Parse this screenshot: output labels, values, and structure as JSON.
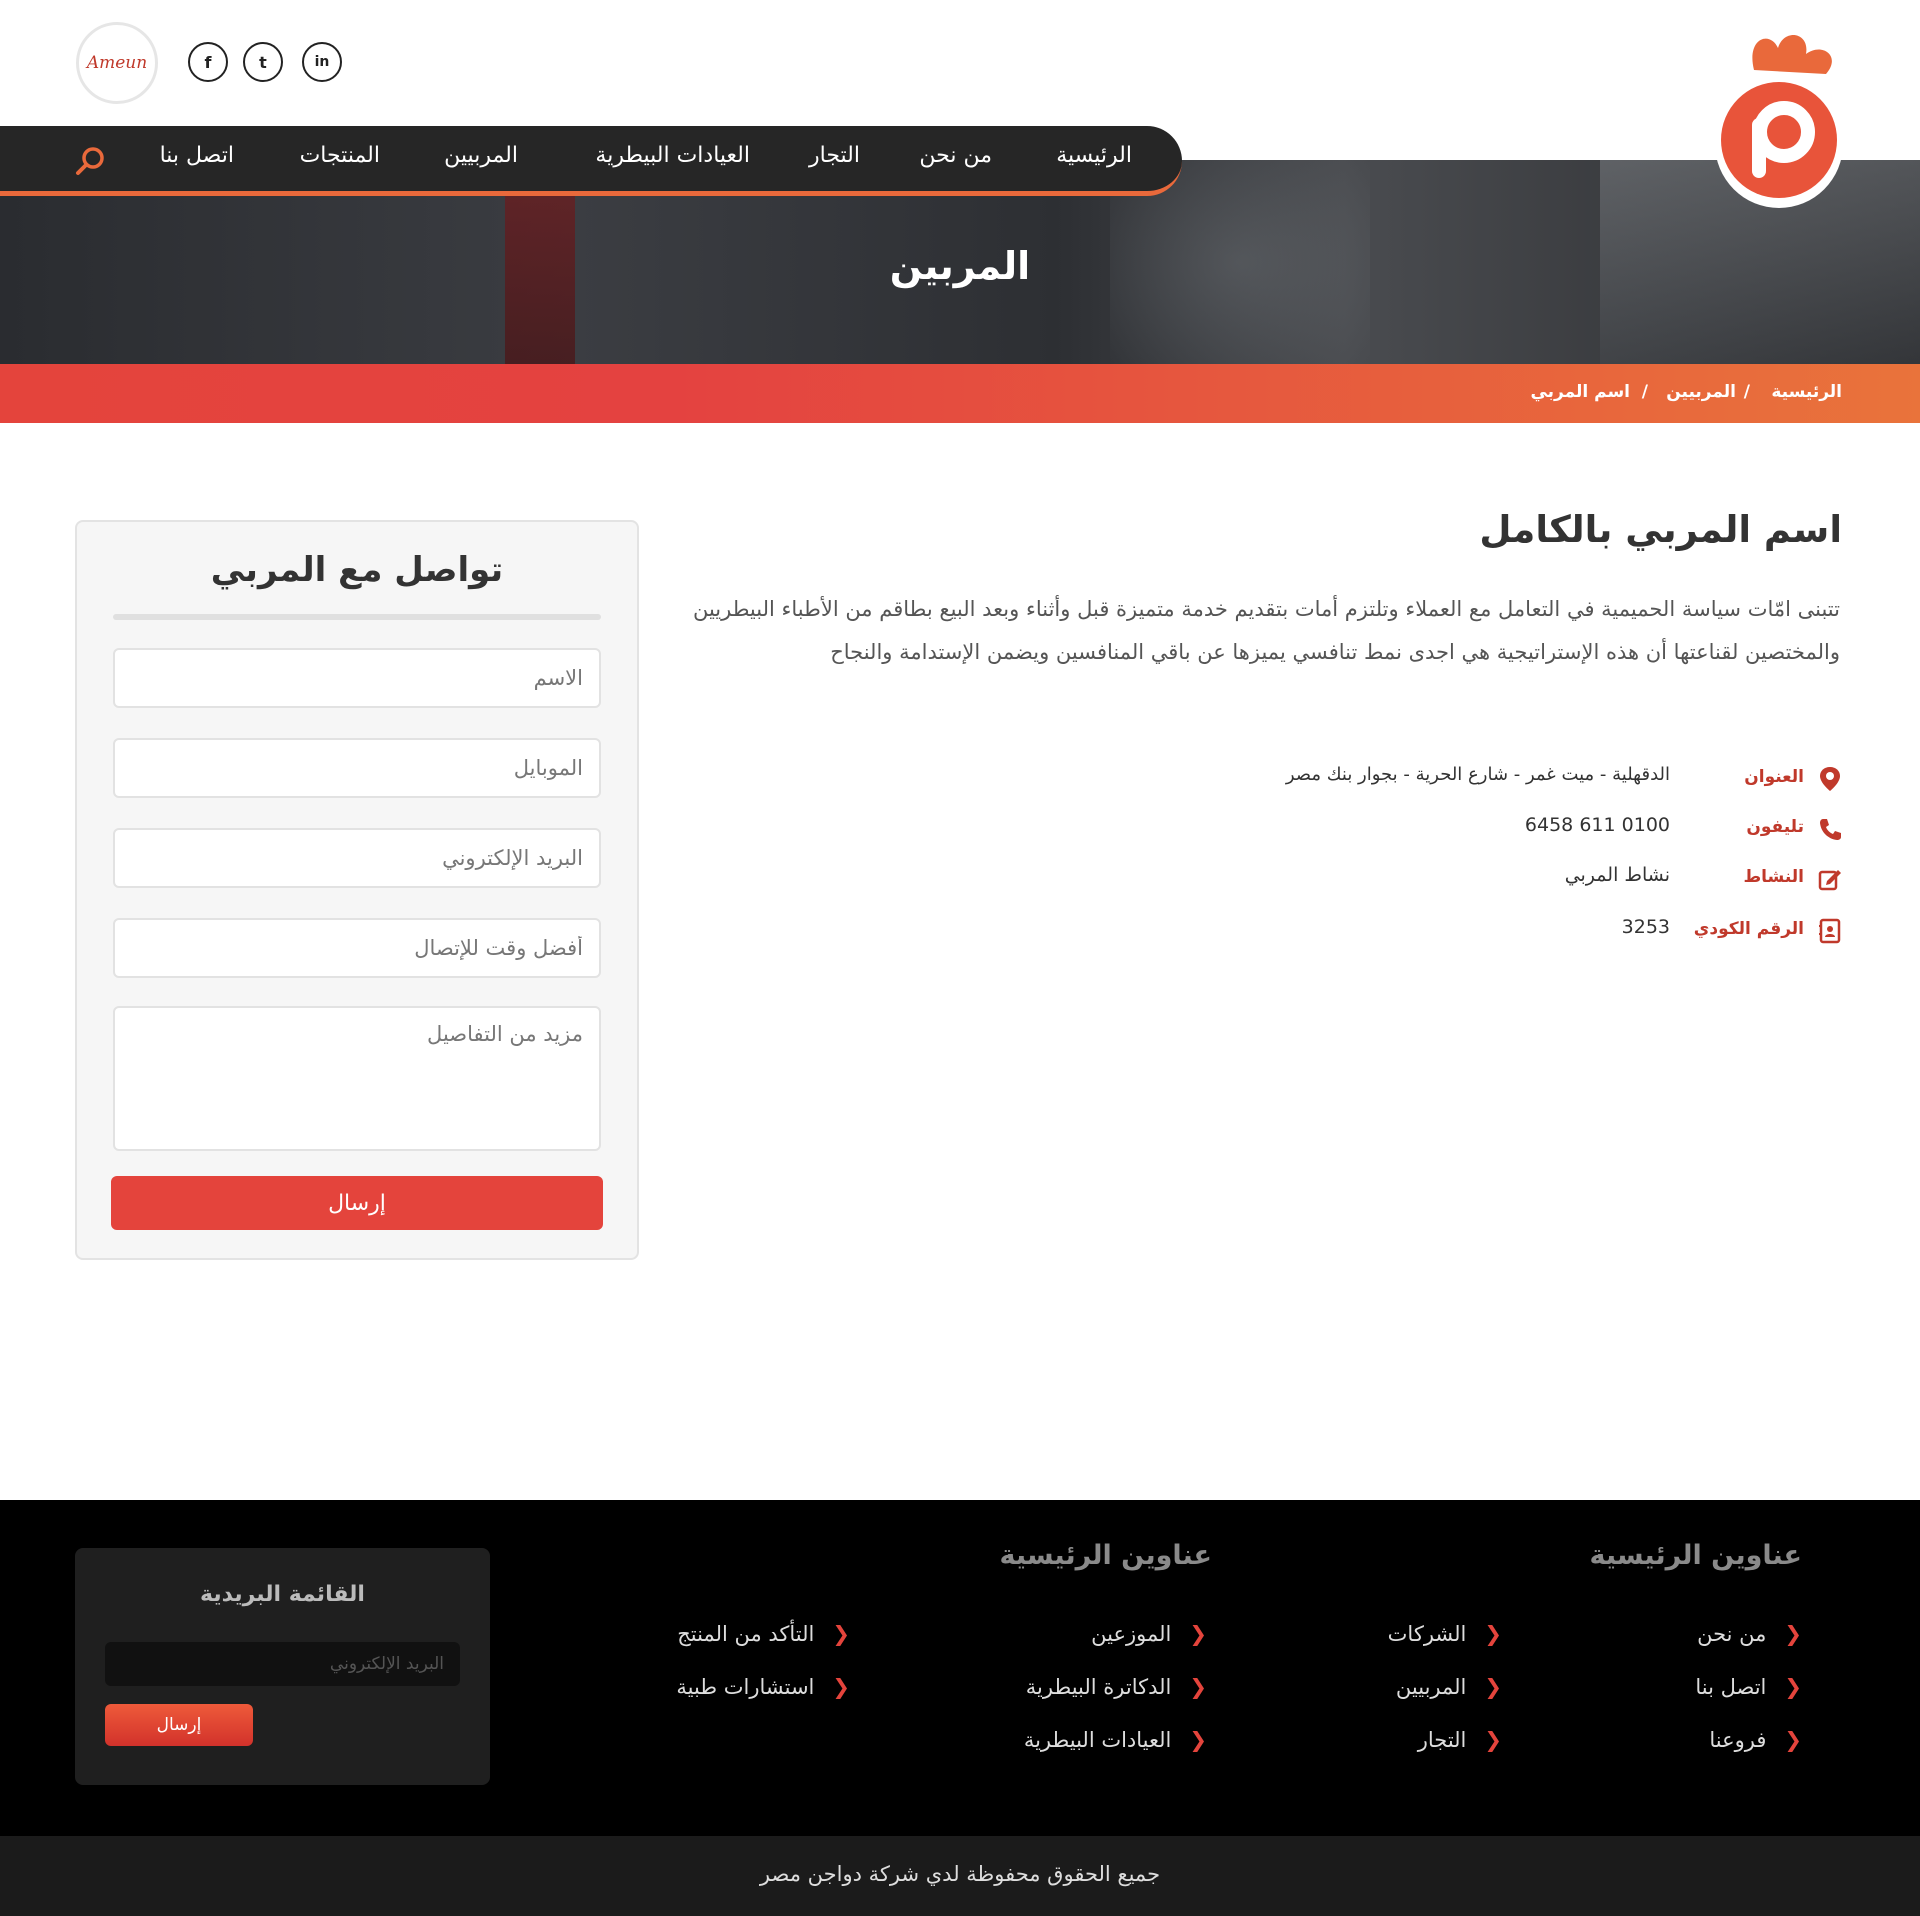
{
  "header": {
    "partner_logo_text": "Ameun",
    "social": [
      "f",
      "t",
      "in"
    ]
  },
  "nav": {
    "items": [
      "الرئيسية",
      "من نحن",
      "التجار",
      "العيادات البيطرية",
      "المربيين",
      "المنتجات",
      "اتصل بنا"
    ]
  },
  "hero": {
    "title": "المربين"
  },
  "breadcrumb": {
    "home": "الرئيسية",
    "sep": "/",
    "section": "المربيين",
    "current": "اسم المربي"
  },
  "breeder": {
    "name": "اسم المربي بالكامل",
    "description": "تتبنى امّات سياسة الحميمية في التعامل مع العملاء وتلتزم أمات بتقديم خدمة متميزة قبل وأثناء وبعد البيع بطاقم من الأطباء البيطريين والمختصين لقناعتها أن هذه الإستراتيجية هي اجدى نمط تنافسي يميزها عن باقي المنافسين ويضمن الإستدامة والنجاح",
    "info": {
      "address_label": "العنوان",
      "address": "الدقهلية - ميت غمر - شارع الحرية - بجوار بنك مصر",
      "phone_label": "تليفون",
      "phone": "0100 611 6458",
      "activity_label": "النشاط",
      "activity": "نشاط المربي",
      "code_label": "الرقم الكودي",
      "code": "3253"
    }
  },
  "contact_form": {
    "title": "تواصل مع المربي",
    "name_placeholder": "الاسم",
    "mobile_placeholder": "الموبايل",
    "email_placeholder": "البريد الإلكتروني",
    "time_placeholder": "أفضل وقت للإتصال",
    "details_placeholder": "مزيد من التفاصيل",
    "submit": "إرسال"
  },
  "footer": {
    "col1_title": "عناوين الرئيسية",
    "col1_links": [
      "من نحن",
      "اتصل بنا",
      "فروعنا"
    ],
    "col2_links": [
      "الشركات",
      "المربيين",
      "التجار"
    ],
    "col3_title": "عناوين الرئيسية",
    "col3_links": [
      "الموزعين",
      "الدكاترة البيطرية",
      "العيادات البيطرية"
    ],
    "col4_links": [
      "التأكد من المنتج",
      "استشارات طبية"
    ],
    "chevron": "❮",
    "newsletter": {
      "title": "القائمة البريدية",
      "placeholder": "البريد الإلكتروني",
      "submit": "إرسال"
    },
    "copyright": "جميع الحقوق محفوظة لدي شركة دواجن مصر"
  },
  "colors": {
    "accent": "#e4443c",
    "accent_orange": "#e9733b",
    "nav_bg": "#262626",
    "footer_bg": "#000000"
  }
}
